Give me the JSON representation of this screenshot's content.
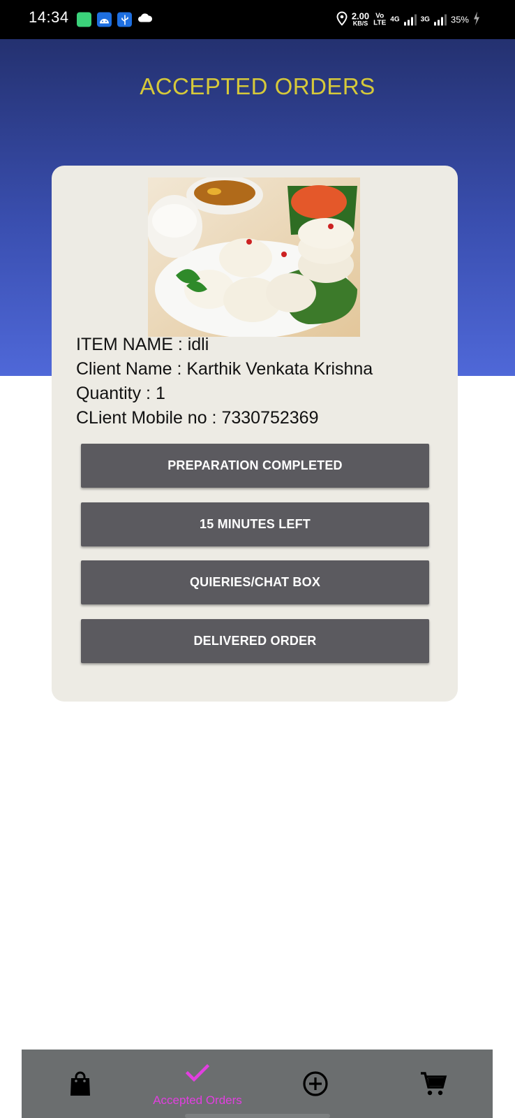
{
  "status_bar": {
    "time": "14:34",
    "net_speed_value": "2.00",
    "net_speed_unit": "KB/S",
    "volte_top": "Vo",
    "volte_bottom": "LTE",
    "net4g": "4G",
    "net3g": "3G",
    "battery": "35%"
  },
  "header": {
    "title": "ACCEPTED ORDERS"
  },
  "order": {
    "item_name": "ITEM NAME : idli",
    "client_name": "Client Name : Karthik Venkata Krishna",
    "quantity": "Quantity : 1",
    "client_mobile": "CLient Mobile no : 7330752369"
  },
  "buttons": {
    "prep_completed": "PREPARATION COMPLETED",
    "minutes_left": "15 MINUTES LEFT",
    "chat": "QUIERIES/CHAT BOX",
    "delivered": "DELIVERED ORDER"
  },
  "bottom_nav": {
    "items": [
      {
        "icon": "shopping-bag-icon",
        "label": ""
      },
      {
        "icon": "check-icon",
        "label": "Accepted Orders",
        "active": true
      },
      {
        "icon": "add-circle-icon",
        "label": ""
      },
      {
        "icon": "cart-icon",
        "label": ""
      }
    ]
  },
  "colors": {
    "header_top": "#243170",
    "header_bottom": "#4f68d8",
    "title": "#d6c93a",
    "card": "#edebe4",
    "button": "#5b5a5f",
    "nav_bg": "#6b6e6f",
    "nav_active": "#e23fe0"
  }
}
